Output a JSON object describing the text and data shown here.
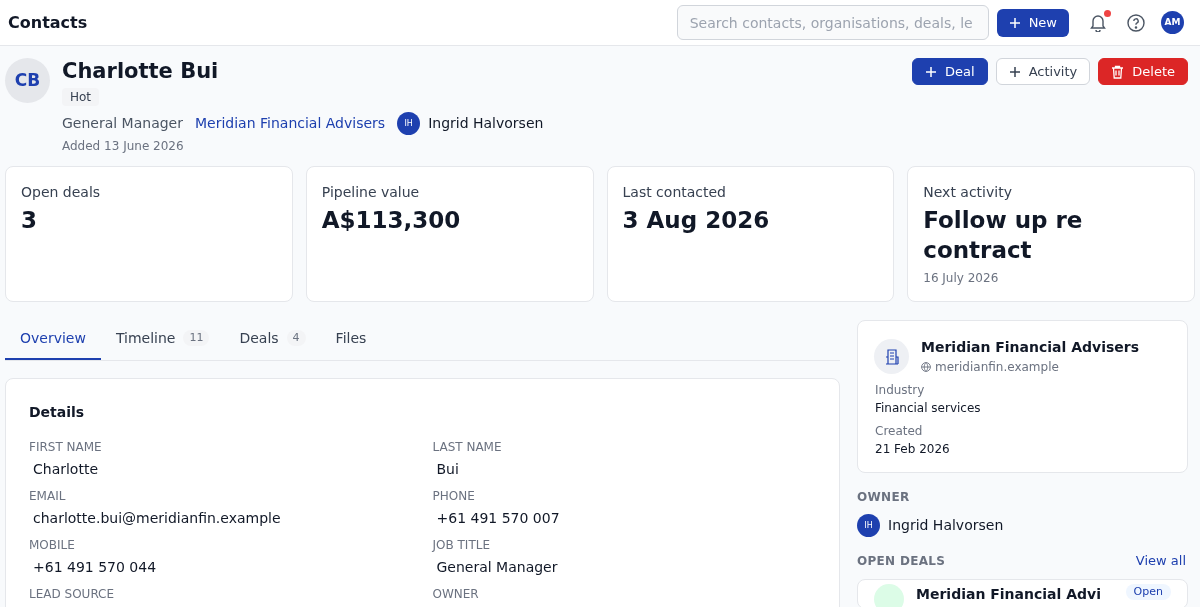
{
  "header": {
    "title": "Contacts",
    "search": {
      "placeholder": "Search contacts, organisations, deals, le"
    },
    "new_button": "New",
    "notifications_unread": true,
    "user_initials": "AM"
  },
  "contact": {
    "initials": "CB",
    "name": "Charlotte Bui",
    "tag": "Hot",
    "job_title": "General Manager",
    "organisation": "Meridian Financial Advisers",
    "owner": {
      "initials": "IH",
      "name": "Ingrid Halvorsen"
    },
    "added": "Added 13 June 2026"
  },
  "actions": [
    {
      "kind": "primary",
      "label": "Deal"
    },
    {
      "kind": "secondary",
      "label": "Activity"
    },
    {
      "kind": "danger",
      "label": "Delete"
    }
  ],
  "stats": [
    {
      "label": "Open deals",
      "value": "3"
    },
    {
      "label": "Pipeline value",
      "value": "A$113,300"
    },
    {
      "label": "Last contacted",
      "value": "3 Aug 2026"
    },
    {
      "label": "Next activity",
      "value": "Follow up re contract",
      "sub": "16 July 2026"
    }
  ],
  "tabs": [
    {
      "label": "Overview",
      "selected": true
    },
    {
      "label": "Timeline",
      "count": "11",
      "selected": false
    },
    {
      "label": "Deals",
      "count": "4",
      "selected": false
    },
    {
      "label": "Files",
      "selected": false
    }
  ],
  "details": {
    "title": "Details",
    "fields": [
      {
        "label": "FIRST NAME",
        "value": "Charlotte"
      },
      {
        "label": "LAST NAME",
        "value": "Bui"
      },
      {
        "label": "EMAIL",
        "value": "charlotte.bui@meridianfin.example"
      },
      {
        "label": "PHONE",
        "value": "+61 491 570 007"
      },
      {
        "label": "MOBILE",
        "value": "+61 491 570 044"
      },
      {
        "label": "JOB TITLE",
        "value": "General Manager"
      },
      {
        "label": "LEAD SOURCE"
      },
      {
        "label": "OWNER"
      }
    ]
  },
  "organisation_card": {
    "name": "Meridian Financial Advisers",
    "website": "meridianfin.example",
    "facts": [
      {
        "label": "Industry",
        "value": "Financial services"
      },
      {
        "label": "Created",
        "value": "21 Feb 2026"
      }
    ]
  },
  "owner_section": {
    "title": "OWNER",
    "initials": "IH",
    "name": "Ingrid Halvorsen"
  },
  "open_deals": {
    "title": "OPEN DEALS",
    "link": "View all",
    "deals": [
      {
        "name": "Meridian Financial Advi",
        "status": "Open"
      }
    ]
  }
}
